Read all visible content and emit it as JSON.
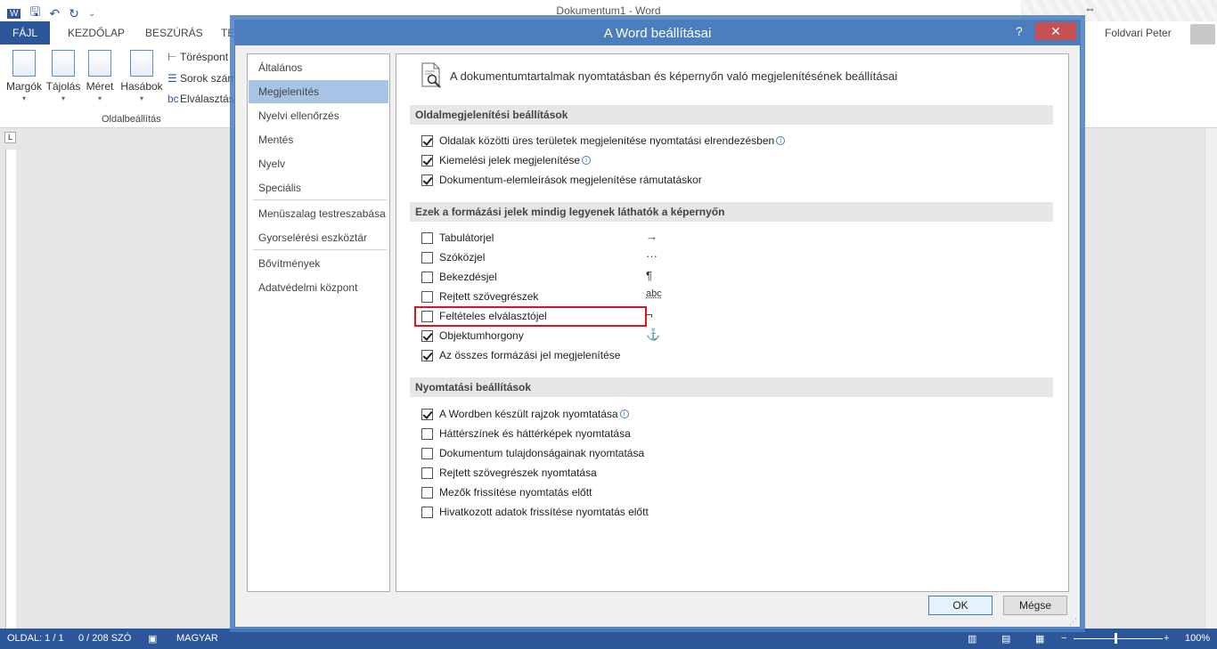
{
  "window": {
    "title": "Dokumentum1 - Word",
    "user": "Foldvari Peter"
  },
  "ribbon": {
    "tabs": [
      "FÁJL",
      "KEZDŐLAP",
      "BESZÚRÁS",
      "TER"
    ],
    "buttons": [
      {
        "label": "Margók"
      },
      {
        "label": "Tájolás"
      },
      {
        "label": "Méret"
      },
      {
        "label": "Hasábok"
      }
    ],
    "small_buttons": [
      "Töréspont",
      "Sorok szám",
      "Elválasztás"
    ],
    "group_label": "Oldalbeállítás"
  },
  "statusbar": {
    "page": "OLDAL: 1 / 1",
    "words": "0 / 208 SZÓ",
    "language": "MAGYAR",
    "zoom": "100%"
  },
  "dialog": {
    "title": "A Word beállításai",
    "help": "?",
    "close": "✕",
    "nav": {
      "items": [
        "Általános",
        "Megjelenítés",
        "Nyelvi ellenőrzés",
        "Mentés",
        "Nyelv",
        "Speciális",
        "Menüszalag testreszabása",
        "Gyorselérési eszköztár",
        "Bővítmények",
        "Adatvédelmi központ"
      ],
      "selected": "Megjelenítés"
    },
    "header": "A dokumentumtartalmak nyomtatásban és képernyőn való megjelenítésének beállításai",
    "sections": {
      "page": {
        "title": "Oldalmegjelenítési beállítások",
        "options": [
          {
            "label": "Oldalak közötti üres területek megjelenítése nyomtatási elrendezésben",
            "checked": true,
            "info": true
          },
          {
            "label": "Kiemelési jelek megjelenítése",
            "checked": true,
            "info": true
          },
          {
            "label": "Dokumentum-elemleírások megjelenítése rámutatáskor",
            "checked": true,
            "info": false
          }
        ]
      },
      "marks": {
        "title": "Ezek a formázási jelek mindig legyenek láthatók a képernyőn",
        "options": [
          {
            "label": "Tabulátorjel",
            "checked": false,
            "symbol": "→"
          },
          {
            "label": "Szóközjel",
            "checked": false,
            "symbol": "···"
          },
          {
            "label": "Bekezdésjel",
            "checked": false,
            "symbol": "¶"
          },
          {
            "label": "Rejtett szövegrészek",
            "checked": false,
            "symbol": "abc"
          },
          {
            "label": "Feltételes elválasztójel",
            "checked": false,
            "symbol": "¬"
          },
          {
            "label": "Objektumhorgony",
            "checked": true,
            "symbol": "⚓"
          },
          {
            "label": "Az összes formázási jel megjelenítése",
            "checked": true,
            "symbol": ""
          }
        ]
      },
      "print": {
        "title": "Nyomtatási beállítások",
        "options": [
          {
            "label": "A Wordben készült rajzok nyomtatása",
            "checked": true,
            "info": true
          },
          {
            "label": "Háttérszínek és háttérképek nyomtatása",
            "checked": false
          },
          {
            "label": "Dokumentum tulajdonságainak nyomtatása",
            "checked": false
          },
          {
            "label": "Rejtett szövegrészek nyomtatása",
            "checked": false
          },
          {
            "label": "Mezők frissítése nyomtatás előtt",
            "checked": false
          },
          {
            "label": "Hivatkozott adatok frissítése nyomtatás előtt",
            "checked": false
          }
        ]
      }
    },
    "buttons": {
      "ok": "OK",
      "cancel": "Mégse"
    }
  },
  "colors": {
    "accent": "#2b579a",
    "dialog_title": "#4a7ebf",
    "highlight": "#e0141e"
  }
}
